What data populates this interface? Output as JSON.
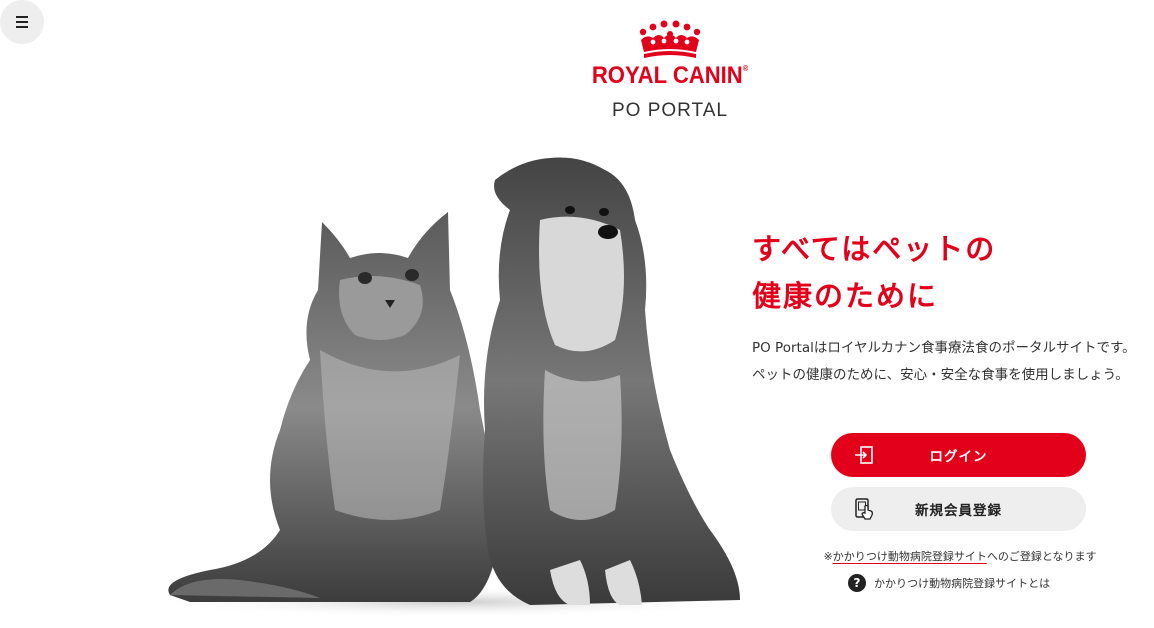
{
  "menu": {
    "icon": "hamburger-icon"
  },
  "logo": {
    "icon": "crown-icon",
    "brand_text": "ROYAL CANIN",
    "brand_mark": "®",
    "brand_color": "#e2001a",
    "subtitle": "PO PORTAL"
  },
  "hero": {
    "icon": "cat-and-dog-photo"
  },
  "headline": {
    "line1": "すべてはペットの",
    "line2": "健康のために"
  },
  "description": {
    "line1": "PO Portalはロイヤルカナン食事療法食のポータルサイトです。",
    "line2": "ペットの健康のために、安心・安全な食事を使用しましょう。"
  },
  "buttons": {
    "login_label": "ログイン",
    "login_icon": "login-icon",
    "register_label": "新規会員登録",
    "register_icon": "phone-touch-icon"
  },
  "note": {
    "prefix": "※",
    "link_text": "かかりつけ動物病院登録サイト",
    "suffix": "へのご登録となります"
  },
  "help": {
    "icon": "question-icon",
    "glyph": "?",
    "text": "かかりつけ動物病院登録サイトとは"
  },
  "colors": {
    "accent": "#e2001a",
    "secondary_button": "#eeeeee"
  }
}
